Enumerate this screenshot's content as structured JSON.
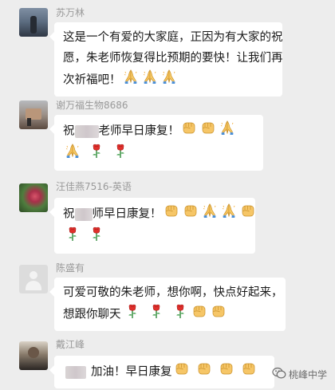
{
  "messages": [
    {
      "sender": "苏万林",
      "lines": [
        "这是一个有爱的大家庭，正因为有大家的祝",
        "愿，朱老师恢复得比预期的要快！让我们再",
        "次祈福吧！"
      ],
      "trailing_emoji": [
        "pray",
        "pray",
        "pray"
      ]
    },
    {
      "sender": "谢万福生物8686",
      "line1_prefix": "祝",
      "line1_text": "老师早日康复！",
      "line1_emoji": [
        "fist",
        "fist",
        "pray"
      ],
      "line2_emoji": [
        "pray",
        "rose",
        "rose"
      ]
    },
    {
      "sender": "汪佳燕7516-英语",
      "line1_prefix": "祝",
      "line1_text": "师早日康复！",
      "line1_emoji": [
        "fist",
        "fist",
        "pray",
        "pray",
        "fist"
      ],
      "line2_emoji": [
        "rose",
        "rose"
      ]
    },
    {
      "sender": "陈盛有",
      "line1_text": "可爱可敬的朱老师，想你啊，快点好起来，",
      "line2_text": "想跟你聊天",
      "line2_emoji": [
        "rose",
        "rose",
        "rose",
        "fist",
        "fist"
      ]
    },
    {
      "sender": "戴江峰",
      "line1_text": "加油！早日康复",
      "line1_emoji": [
        "fist",
        "fist",
        "fist",
        "fist"
      ]
    }
  ],
  "watermark": {
    "text": "桃峰中学",
    "icon": "wechat-official-account-icon"
  },
  "colors": {
    "background": "#ededed",
    "bubble": "#ffffff",
    "sender_name": "#9a9a9a",
    "text": "#1a1a1a"
  }
}
